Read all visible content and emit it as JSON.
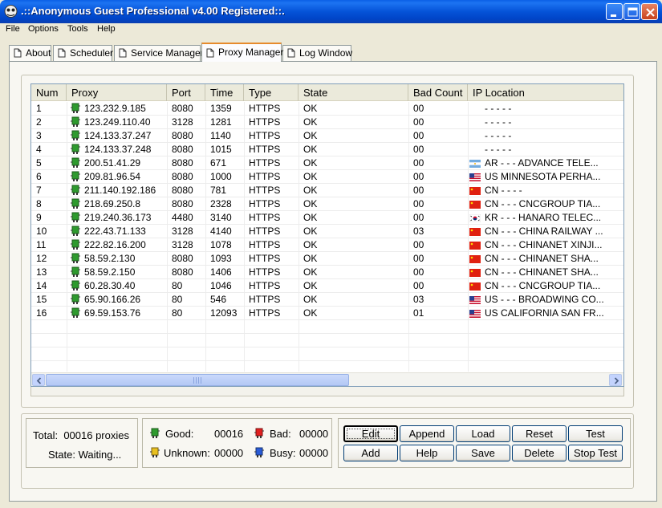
{
  "window": {
    "title": ".::Anonymous Guest Professional v4.00 Registered::."
  },
  "menu": [
    "File",
    "Options",
    "Tools",
    "Help"
  ],
  "tabs": [
    "About",
    "Scheduler",
    "Service Manager",
    "Proxy Manager",
    "Log Window"
  ],
  "active_tab": "Proxy Manager",
  "table": {
    "columns": [
      "Num",
      "Proxy",
      "Port",
      "Time",
      "Type",
      "State",
      "Bad Count",
      "IP Location"
    ],
    "rows": [
      {
        "num": "1",
        "proxy": "123.232.9.185",
        "port": "8080",
        "time": "1359",
        "type": "HTTPS",
        "state": "OK",
        "bad": "00",
        "ip": "- - - - -",
        "flag": ""
      },
      {
        "num": "2",
        "proxy": "123.249.110.40",
        "port": "3128",
        "time": "1281",
        "type": "HTTPS",
        "state": "OK",
        "bad": "00",
        "ip": "- - - - -",
        "flag": ""
      },
      {
        "num": "3",
        "proxy": "124.133.37.247",
        "port": "8080",
        "time": "1140",
        "type": "HTTPS",
        "state": "OK",
        "bad": "00",
        "ip": "- - - - -",
        "flag": ""
      },
      {
        "num": "4",
        "proxy": "124.133.37.248",
        "port": "8080",
        "time": "1015",
        "type": "HTTPS",
        "state": "OK",
        "bad": "00",
        "ip": "- - - - -",
        "flag": ""
      },
      {
        "num": "5",
        "proxy": "200.51.41.29",
        "port": "8080",
        "time": "671",
        "type": "HTTPS",
        "state": "OK",
        "bad": "00",
        "ip": "AR - - - ADVANCE TELE...",
        "flag": "ar"
      },
      {
        "num": "6",
        "proxy": "209.81.96.54",
        "port": "8080",
        "time": "1000",
        "type": "HTTPS",
        "state": "OK",
        "bad": "00",
        "ip": "US MINNESOTA PERHA...",
        "flag": "us"
      },
      {
        "num": "7",
        "proxy": "211.140.192.186",
        "port": "8080",
        "time": "781",
        "type": "HTTPS",
        "state": "OK",
        "bad": "00",
        "ip": "CN - - - -",
        "flag": "cn"
      },
      {
        "num": "8",
        "proxy": "218.69.250.8",
        "port": "8080",
        "time": "2328",
        "type": "HTTPS",
        "state": "OK",
        "bad": "00",
        "ip": "CN - - - CNCGROUP TIA...",
        "flag": "cn"
      },
      {
        "num": "9",
        "proxy": "219.240.36.173",
        "port": "4480",
        "time": "3140",
        "type": "HTTPS",
        "state": "OK",
        "bad": "00",
        "ip": "KR - - - HANARO TELEC...",
        "flag": "kr"
      },
      {
        "num": "10",
        "proxy": "222.43.71.133",
        "port": "3128",
        "time": "4140",
        "type": "HTTPS",
        "state": "OK",
        "bad": "03",
        "ip": "CN - - - CHINA RAILWAY ...",
        "flag": "cn"
      },
      {
        "num": "11",
        "proxy": "222.82.16.200",
        "port": "3128",
        "time": "1078",
        "type": "HTTPS",
        "state": "OK",
        "bad": "00",
        "ip": "CN - - - CHINANET XINJI...",
        "flag": "cn"
      },
      {
        "num": "12",
        "proxy": "58.59.2.130",
        "port": "8080",
        "time": "1093",
        "type": "HTTPS",
        "state": "OK",
        "bad": "00",
        "ip": "CN - - - CHINANET SHA...",
        "flag": "cn"
      },
      {
        "num": "13",
        "proxy": "58.59.2.150",
        "port": "8080",
        "time": "1406",
        "type": "HTTPS",
        "state": "OK",
        "bad": "00",
        "ip": "CN - - - CHINANET SHA...",
        "flag": "cn"
      },
      {
        "num": "14",
        "proxy": "60.28.30.40",
        "port": "80",
        "time": "1046",
        "type": "HTTPS",
        "state": "OK",
        "bad": "00",
        "ip": "CN - - - CNCGROUP TIA...",
        "flag": "cn"
      },
      {
        "num": "15",
        "proxy": "65.90.166.26",
        "port": "80",
        "time": "546",
        "type": "HTTPS",
        "state": "OK",
        "bad": "03",
        "ip": "US - - - BROADWING CO...",
        "flag": "us"
      },
      {
        "num": "16",
        "proxy": "69.59.153.76",
        "port": "80",
        "time": "12093",
        "type": "HTTPS",
        "state": "OK",
        "bad": "01",
        "ip": "US CALIFORNIA SAN FR...",
        "flag": "us"
      }
    ]
  },
  "summary": {
    "total_label": "Total:",
    "total_value": "00016 proxies",
    "state_label": "State:",
    "state_value": "Waiting..."
  },
  "status": {
    "good_label": "Good:",
    "good_value": "00016",
    "bad_label": "Bad:",
    "bad_value": "00000",
    "unknown_label": "Unknown:",
    "unknown_value": "00000",
    "busy_label": "Busy:",
    "busy_value": "00000"
  },
  "buttons": [
    "Edit",
    "Append",
    "Load",
    "Reset",
    "Test",
    "Add",
    "Help",
    "Save",
    "Delete",
    "Stop Test"
  ],
  "colors": {
    "good": "#2E9A2E",
    "bad": "#E02020",
    "unknown": "#E8C020",
    "busy": "#2A5BD7"
  }
}
